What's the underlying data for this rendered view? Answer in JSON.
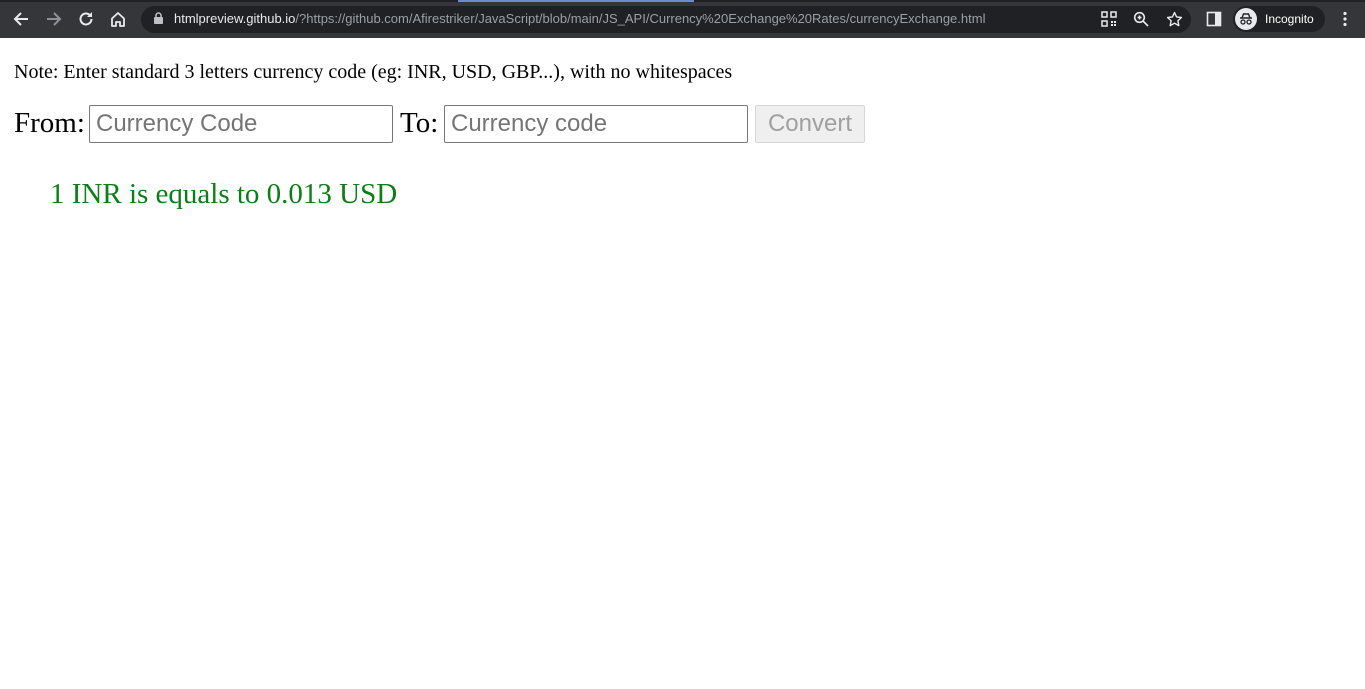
{
  "browser": {
    "url_host": "htmlpreview.github.io",
    "url_rest": "/?https://github.com/Afirestriker/JavaScript/blob/main/JS_API/Currency%20Exchange%20Rates/currencyExchange.html",
    "profile_label": "Incognito",
    "icons": [
      "back-icon",
      "forward-icon",
      "reload-icon",
      "home-icon",
      "lock-icon",
      "qr-code-icon",
      "zoom-icon",
      "bookmark-star-icon",
      "side-panel-icon",
      "incognito-icon",
      "menu-dots-icon"
    ]
  },
  "page": {
    "note": "Note: Enter standard 3 letters currency code (eg: INR, USD, GBP...), with no whitespaces",
    "from_label": "From:",
    "from_placeholder": "Currency Code",
    "to_label": "To:",
    "to_placeholder": "Currency code",
    "convert_label": "Convert",
    "result": "1 INR is equals to 0.013 USD"
  },
  "colors": {
    "chrome_bg": "#35363a",
    "omnibox_bg": "#202124",
    "result_text": "#0a7f16",
    "button_disabled_text": "#a0a0a0"
  }
}
